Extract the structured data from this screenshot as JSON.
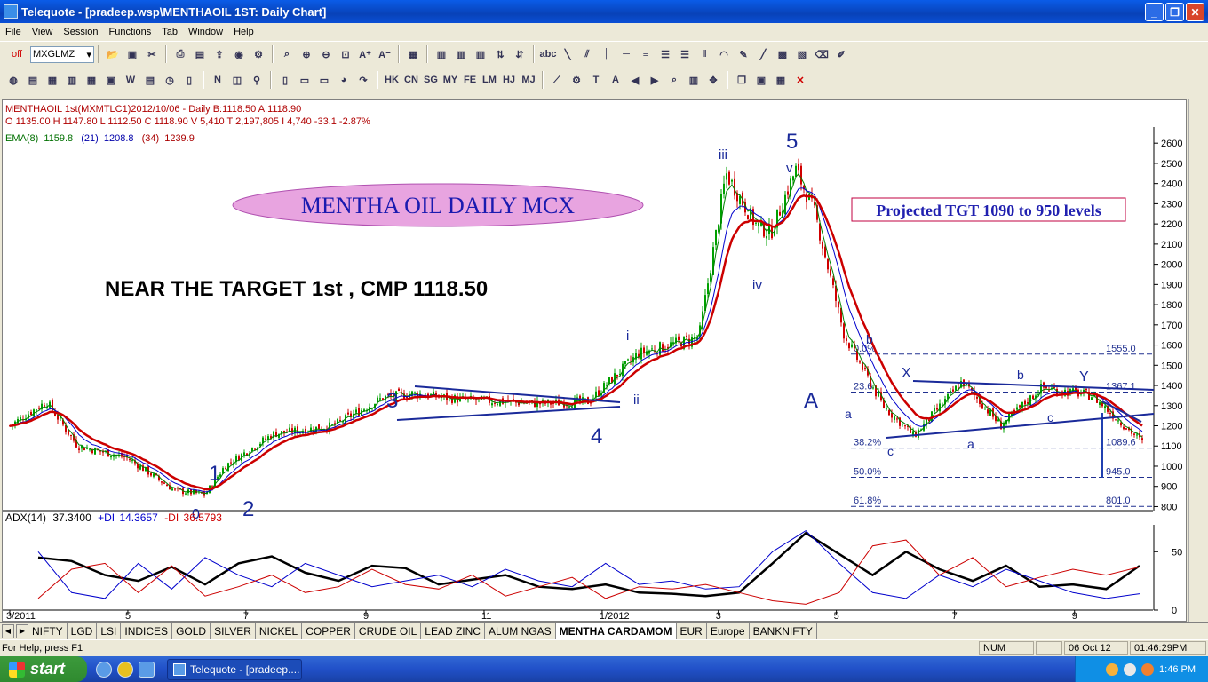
{
  "window": {
    "title": "Telequote - [pradeep.wsp\\MENTHAOIL 1ST: Daily Chart]"
  },
  "menu": [
    "File",
    "View",
    "Session",
    "Functions",
    "Tab",
    "Window",
    "Help"
  ],
  "toolbar": {
    "off_label": "off",
    "symbol_value": "MXGLMZ",
    "abc_label": "abc",
    "exchange_buttons": [
      "HK",
      "CN",
      "SG",
      "MY",
      "FE",
      "LM",
      "HJ",
      "MJ"
    ]
  },
  "chart_header": {
    "line1": "MENTHAOIL 1st(MXMTLC1)2012/10/06  - Daily B:1118.50 A:1118.90",
    "line2": "O 1135.00 H 1147.80 L 1112.50 C 1118.90 V 5,410 T 2,197,805 I 4,740  -33.1  -2.87%",
    "ema_label": "EMA(8)",
    "ema8_value": "1159.8",
    "ema21_label": "(21)",
    "ema21_value": "1208.8",
    "ema34_label": "(34)",
    "ema34_value": "1239.9"
  },
  "annotations": {
    "title_oval": "MENTHA  OIL  DAILY  MCX",
    "target_box": "Projected TGT 1090 to 950 levels",
    "near_target": "NEAR THE TARGET 1st , CMP 1118.50"
  },
  "chart_data": [
    {
      "type": "candlestick",
      "title": "MENTHAOIL 1st(MXMTLC1)",
      "ylim": [
        780,
        2680
      ],
      "y_ticks": [
        800,
        900,
        1000,
        1100,
        1200,
        1300,
        1400,
        1500,
        1600,
        1700,
        1800,
        1900,
        2000,
        2100,
        2200,
        2300,
        2400,
        2500,
        2600
      ],
      "x_tick_labels": [
        "3/2011",
        "5",
        "7",
        "9",
        "11",
        "1/2012",
        "3",
        "5",
        "7",
        "9"
      ],
      "approx_close_path": {
        "x": [
          "2011-03-01",
          "2011-03-20",
          "2011-04-05",
          "2011-05-01",
          "2011-05-25",
          "2011-06-10",
          "2011-06-20",
          "2011-07-15",
          "2011-08-15",
          "2011-09-10",
          "2011-09-25",
          "2011-10-20",
          "2011-11-30",
          "2011-12-25",
          "2012-01-20",
          "2012-02-20",
          "2012-03-05",
          "2012-03-20",
          "2012-03-28",
          "2012-04-10",
          "2012-04-20",
          "2012-05-05",
          "2012-05-25",
          "2012-06-10",
          "2012-07-05",
          "2012-07-25",
          "2012-08-15",
          "2012-09-10",
          "2012-10-06"
        ],
        "close": [
          1200,
          1320,
          1100,
          1040,
          880,
          860,
          1000,
          1160,
          1200,
          1340,
          1360,
          1330,
          1310,
          1320,
          1560,
          1640,
          2450,
          2200,
          2150,
          2470,
          2250,
          1650,
          1300,
          1150,
          1420,
          1200,
          1390,
          1350,
          1118.5
        ]
      },
      "indicators": [
        {
          "name": "EMA(8)",
          "value": 1159.8,
          "color": "#008000"
        },
        {
          "name": "EMA(21)",
          "value": 1208.8,
          "color": "#0000cc"
        },
        {
          "name": "EMA(34)",
          "value": 1239.9,
          "color": "#cc0000"
        }
      ],
      "wave_labels": [
        "0",
        "1",
        "2",
        "3",
        "4",
        "i",
        "ii",
        "iii",
        "iv",
        "v",
        "5",
        "A",
        "a",
        "b",
        "c",
        "X",
        "a",
        "b",
        "c",
        "Y"
      ],
      "fibonacci_levels": [
        {
          "label": "0.0%",
          "value": 1555.0
        },
        {
          "label": "23.6",
          "value": 1367.1
        },
        {
          "label": "38.2%",
          "value": 1089.6
        },
        {
          "label": "50.0%",
          "value": 945.0
        },
        {
          "label": "61.8%",
          "value": 801.0
        }
      ],
      "fib_value_labels": [
        "1555.0",
        "1367.1",
        "1089.6",
        "945.0",
        "801.0"
      ]
    },
    {
      "type": "line",
      "title": "ADX(14)",
      "adx_label": "ADX(14)",
      "adx_value": "37.3400",
      "pdi_label": "+DI",
      "pdi_value": "14.3657",
      "mdi_label": "-DI",
      "mdi_value": "36.5793",
      "ylim": [
        0,
        70
      ],
      "y_ticks": [
        0,
        50
      ],
      "series": [
        {
          "name": "ADX(14)",
          "color": "#000000",
          "values": [
            45,
            42,
            30,
            25,
            37,
            22,
            40,
            46,
            32,
            25,
            38,
            36,
            22,
            26,
            30,
            20,
            18,
            22,
            15,
            14,
            12,
            15,
            40,
            66,
            48,
            30,
            50,
            35,
            25,
            38,
            20,
            22,
            18,
            38
          ]
        },
        {
          "name": "+DI",
          "color": "#0000cc",
          "values": [
            50,
            15,
            10,
            40,
            18,
            45,
            30,
            20,
            40,
            30,
            20,
            25,
            30,
            20,
            35,
            25,
            20,
            40,
            22,
            25,
            18,
            20,
            50,
            68,
            40,
            15,
            10,
            30,
            20,
            35,
            25,
            15,
            10,
            14
          ]
        },
        {
          "name": "-DI",
          "color": "#cc0000",
          "values": [
            10,
            35,
            40,
            15,
            38,
            12,
            20,
            30,
            15,
            20,
            35,
            22,
            18,
            30,
            12,
            20,
            28,
            10,
            20,
            18,
            22,
            15,
            8,
            5,
            15,
            55,
            60,
            30,
            45,
            20,
            28,
            35,
            30,
            37
          ]
        }
      ]
    }
  ],
  "tabs": [
    "NIFTY",
    "LGD",
    "LSI",
    "INDICES",
    "GOLD",
    "SILVER",
    "NICKEL",
    "COPPER",
    "CRUDE OIL",
    "LEAD ZINC",
    "ALUM NGAS",
    "MENTHA CARDAMOM",
    "EUR",
    "Europe",
    "BANKNIFTY"
  ],
  "active_tab": "MENTHA CARDAMOM",
  "status": {
    "help": "For Help, press F1",
    "num": "NUM",
    "date": "06 Oct 12",
    "time": "01:46:29PM"
  },
  "taskbar": {
    "start": "start",
    "task_item": "Telequote - [pradeep....",
    "clock": "1:46 PM"
  }
}
